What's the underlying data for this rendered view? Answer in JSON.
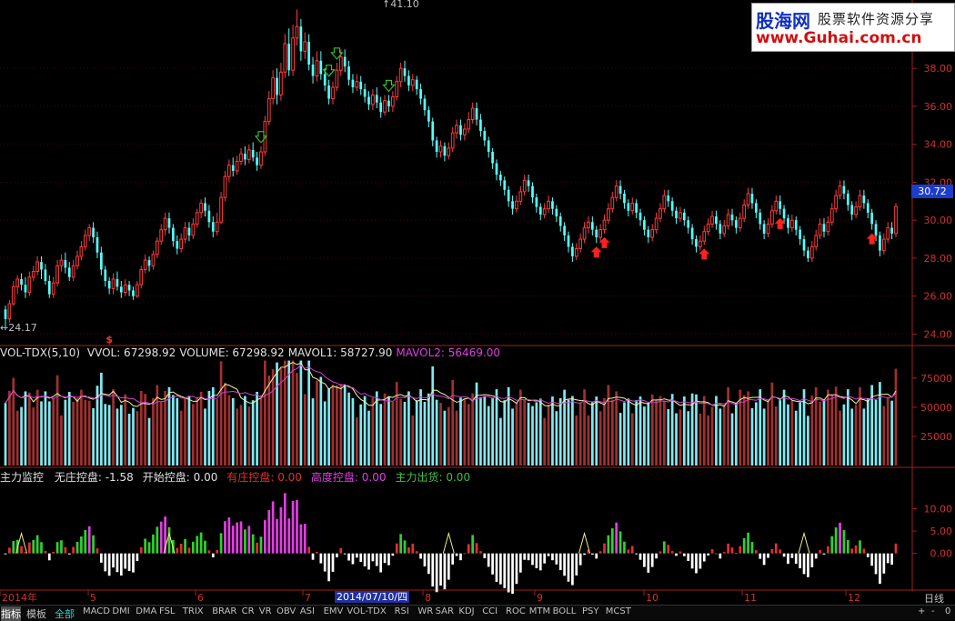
{
  "logo": {
    "brand": "股海网",
    "tagline": "股票软件资源分享",
    "url": "www.Guhai.com.cn"
  },
  "current_price": "30.72",
  "high_label": "41.10",
  "low_label": "←24.17",
  "panels": {
    "volume_title": "VOL-TDX(5,10)",
    "volume_values": [
      {
        "label": "VVOL: 67298.92",
        "color": "#e0e0e0"
      },
      {
        "label": "VOLUME: 67298.92",
        "color": "#e0e0e0"
      },
      {
        "label": "MAVOL1: 58727.90",
        "color": "#e0e0e0"
      },
      {
        "label": "MAVOL2: 56469.00",
        "color": "#e040e0"
      }
    ],
    "indicator_title": "主力监控",
    "indicator_values": [
      {
        "label": "无庄控盘: -1.58",
        "color": "#e0e0e0"
      },
      {
        "label": "开始控盘: 0.00",
        "color": "#e0e0e0"
      },
      {
        "label": "有庄控盘: 0.00",
        "color": "#e03030"
      },
      {
        "label": "高度控盘: 0.00",
        "color": "#e040e0"
      },
      {
        "label": "主力出货: 0.00",
        "color": "#40c040"
      }
    ]
  },
  "axes": {
    "price_ticks": [
      "38.00",
      "36.00",
      "34.00",
      "32.00",
      "30.00",
      "28.00",
      "26.00",
      "24.00"
    ],
    "volume_ticks": [
      "75000",
      "50000",
      "25000"
    ],
    "indicator_ticks": [
      "10.00",
      "5.00",
      "0.00"
    ],
    "months": [
      "2014年",
      "5",
      "6",
      "7",
      "8",
      "9",
      "10",
      "11",
      "12"
    ],
    "cursor_date": "2014/07/10/四",
    "period": "日线"
  },
  "bottom_tabs": {
    "left": [
      "指标",
      "模板",
      "全部"
    ],
    "indicators": [
      "MACD",
      "DMI",
      "DMA",
      "FSL",
      "TRIX",
      "BRAR",
      "CR",
      "VR",
      "OBV",
      "ASI",
      "EMV",
      "VOL-TDX",
      "RSI",
      "WR",
      "SAR",
      "KDJ",
      "CCI",
      "ROC",
      "MTM",
      "BOLL",
      "PSY",
      "MCST"
    ],
    "controls": [
      "+",
      "-",
      "0"
    ]
  },
  "chart_data": {
    "type": "candlestick",
    "ylim": [
      23.4,
      41.6
    ],
    "markers": {
      "sell_arrows_at": [
        64,
        81,
        83,
        96
      ],
      "buy_arrows_at": [
        148,
        150,
        175,
        194,
        217
      ],
      "s_marker_at": 26
    },
    "candles_desc": "[open, close, high, low] per trading day",
    "candles": [
      [
        25.3,
        24.8,
        25.5,
        24.2
      ],
      [
        24.8,
        25.6,
        25.8,
        24.6
      ],
      [
        25.6,
        26.5,
        26.8,
        25.5
      ],
      [
        26.5,
        26.9,
        27.1,
        26.1
      ],
      [
        26.9,
        26.6,
        27.2,
        26.3
      ],
      [
        26.6,
        26.2,
        27.0,
        25.9
      ],
      [
        26.2,
        27.0,
        27.3,
        26.0
      ],
      [
        27.0,
        27.3,
        27.6,
        26.8
      ],
      [
        27.3,
        27.8,
        28.1,
        27.1
      ],
      [
        27.8,
        27.4,
        28.1,
        26.9
      ],
      [
        27.4,
        26.8,
        27.7,
        26.6
      ],
      [
        26.8,
        26.1,
        27.1,
        25.9
      ],
      [
        26.1,
        26.7,
        27.0,
        25.9
      ],
      [
        26.7,
        27.6,
        27.9,
        26.5
      ],
      [
        27.6,
        27.9,
        28.2,
        27.3
      ],
      [
        27.9,
        27.5,
        28.3,
        27.2
      ],
      [
        27.5,
        27.0,
        27.8,
        26.8
      ],
      [
        27.0,
        27.6,
        27.9,
        26.8
      ],
      [
        27.6,
        28.1,
        28.4,
        27.4
      ],
      [
        28.1,
        28.6,
        28.9,
        27.9
      ],
      [
        28.6,
        29.2,
        29.5,
        28.4
      ],
      [
        29.2,
        29.6,
        29.8,
        28.9
      ],
      [
        29.6,
        29.1,
        29.9,
        28.8
      ],
      [
        29.1,
        28.3,
        29.4,
        28.0
      ],
      [
        28.3,
        27.4,
        28.6,
        27.1
      ],
      [
        27.4,
        26.8,
        27.6,
        26.5
      ],
      [
        26.8,
        26.4,
        27.0,
        26.1
      ],
      [
        26.4,
        26.9,
        27.2,
        26.1
      ],
      [
        26.9,
        26.5,
        27.3,
        26.3
      ],
      [
        26.5,
        26.2,
        26.8,
        25.9
      ],
      [
        26.2,
        26.6,
        26.9,
        26.0
      ],
      [
        26.6,
        26.3,
        26.8,
        26.0
      ],
      [
        26.3,
        26.0,
        26.5,
        25.8
      ],
      [
        26.0,
        26.6,
        26.8,
        25.9
      ],
      [
        26.6,
        27.4,
        27.6,
        26.4
      ],
      [
        27.4,
        27.9,
        28.2,
        27.2
      ],
      [
        27.9,
        27.6,
        28.1,
        27.3
      ],
      [
        27.6,
        28.2,
        28.4,
        27.4
      ],
      [
        28.2,
        28.9,
        29.1,
        28.0
      ],
      [
        28.9,
        29.5,
        29.8,
        28.7
      ],
      [
        29.5,
        30.1,
        30.4,
        29.2
      ],
      [
        30.1,
        29.6,
        30.4,
        29.3
      ],
      [
        29.6,
        28.9,
        29.8,
        28.6
      ],
      [
        28.9,
        28.5,
        29.2,
        28.2
      ],
      [
        28.5,
        29.0,
        29.3,
        28.3
      ],
      [
        29.0,
        29.6,
        29.9,
        28.8
      ],
      [
        29.6,
        29.2,
        29.9,
        28.9
      ],
      [
        29.2,
        29.8,
        30.1,
        29.0
      ],
      [
        29.8,
        30.4,
        30.6,
        29.6
      ],
      [
        30.4,
        30.9,
        31.1,
        30.1
      ],
      [
        30.9,
        30.5,
        31.2,
        30.2
      ],
      [
        30.5,
        29.9,
        30.8,
        29.6
      ],
      [
        29.9,
        29.4,
        30.2,
        29.1
      ],
      [
        29.4,
        29.9,
        30.4,
        29.2
      ],
      [
        29.9,
        31.2,
        31.5,
        29.8
      ],
      [
        31.2,
        32.3,
        32.6,
        31.0
      ],
      [
        32.3,
        32.9,
        33.2,
        32.0
      ],
      [
        32.9,
        32.6,
        33.3,
        32.3
      ],
      [
        32.6,
        33.1,
        33.4,
        32.4
      ],
      [
        33.1,
        33.5,
        33.8,
        32.9
      ],
      [
        33.5,
        33.2,
        33.9,
        32.9
      ],
      [
        33.2,
        33.7,
        34.0,
        33.0
      ],
      [
        33.7,
        33.3,
        34.1,
        33.1
      ],
      [
        33.3,
        32.9,
        33.6,
        32.6
      ],
      [
        32.9,
        33.6,
        33.9,
        32.7
      ],
      [
        33.6,
        35.2,
        35.5,
        33.4
      ],
      [
        35.2,
        36.4,
        36.8,
        35.0
      ],
      [
        36.4,
        37.5,
        37.9,
        36.1
      ],
      [
        37.5,
        36.6,
        38.0,
        36.1
      ],
      [
        36.6,
        37.8,
        38.3,
        36.3
      ],
      [
        37.8,
        39.3,
        39.8,
        37.5
      ],
      [
        39.3,
        37.9,
        40.1,
        37.6
      ],
      [
        37.9,
        39.6,
        40.3,
        37.6
      ],
      [
        39.6,
        40.2,
        41.1,
        39.2
      ],
      [
        40.2,
        38.9,
        40.6,
        38.4
      ],
      [
        38.9,
        39.4,
        39.9,
        38.5
      ],
      [
        39.4,
        38.2,
        39.8,
        37.9
      ],
      [
        38.2,
        37.6,
        38.6,
        37.2
      ],
      [
        37.6,
        38.4,
        38.9,
        37.3
      ],
      [
        38.4,
        37.7,
        38.9,
        37.4
      ],
      [
        37.7,
        37.1,
        38.0,
        36.8
      ],
      [
        37.1,
        36.4,
        37.4,
        36.1
      ],
      [
        36.4,
        37.0,
        37.3,
        36.1
      ],
      [
        37.0,
        37.9,
        38.3,
        36.8
      ],
      [
        37.9,
        38.6,
        39.0,
        37.6
      ],
      [
        38.6,
        38.1,
        39.0,
        37.8
      ],
      [
        38.1,
        37.4,
        38.4,
        37.1
      ],
      [
        37.4,
        37.0,
        37.7,
        36.7
      ],
      [
        37.0,
        37.3,
        37.7,
        36.8
      ],
      [
        37.3,
        36.9,
        37.6,
        36.6
      ],
      [
        36.9,
        36.5,
        37.2,
        36.2
      ],
      [
        36.5,
        36.1,
        36.8,
        35.8
      ],
      [
        36.1,
        36.6,
        36.9,
        35.8
      ],
      [
        36.6,
        36.2,
        37.0,
        35.9
      ],
      [
        36.2,
        35.7,
        36.5,
        35.4
      ],
      [
        35.7,
        36.3,
        36.6,
        35.5
      ],
      [
        36.3,
        36.0,
        36.6,
        35.7
      ],
      [
        36.0,
        36.5,
        36.8,
        35.7
      ],
      [
        36.5,
        37.3,
        37.6,
        36.3
      ],
      [
        37.3,
        38.0,
        38.3,
        37.0
      ],
      [
        38.0,
        37.6,
        38.4,
        37.3
      ],
      [
        37.6,
        37.1,
        37.9,
        36.8
      ],
      [
        37.1,
        37.4,
        37.7,
        36.8
      ],
      [
        37.4,
        36.9,
        37.6,
        36.6
      ],
      [
        36.9,
        36.4,
        37.2,
        36.1
      ],
      [
        36.4,
        35.8,
        36.6,
        35.5
      ],
      [
        35.8,
        35.2,
        36.0,
        34.9
      ],
      [
        35.2,
        34.2,
        35.4,
        33.9
      ],
      [
        34.2,
        33.6,
        34.4,
        33.3
      ],
      [
        33.6,
        33.9,
        34.2,
        33.3
      ],
      [
        33.9,
        33.4,
        34.1,
        33.1
      ],
      [
        33.4,
        33.8,
        34.1,
        33.2
      ],
      [
        33.8,
        34.6,
        34.9,
        33.6
      ],
      [
        34.6,
        35.0,
        35.3,
        34.3
      ],
      [
        35.0,
        34.5,
        35.3,
        34.2
      ],
      [
        34.5,
        34.8,
        35.1,
        34.2
      ],
      [
        34.8,
        35.3,
        35.7,
        34.6
      ],
      [
        35.3,
        35.9,
        36.2,
        35.1
      ],
      [
        35.9,
        35.3,
        36.2,
        35.0
      ],
      [
        35.3,
        34.7,
        35.6,
        34.4
      ],
      [
        34.7,
        34.2,
        34.9,
        33.9
      ],
      [
        34.2,
        33.6,
        34.4,
        33.3
      ],
      [
        33.6,
        33.0,
        33.8,
        32.7
      ],
      [
        33.0,
        32.4,
        33.2,
        32.1
      ],
      [
        32.4,
        32.1,
        32.6,
        31.8
      ],
      [
        32.1,
        31.6,
        32.3,
        31.3
      ],
      [
        31.6,
        31.0,
        31.8,
        30.7
      ],
      [
        31.0,
        30.6,
        31.3,
        30.3
      ],
      [
        30.6,
        31.0,
        31.3,
        30.4
      ],
      [
        31.0,
        31.5,
        31.8,
        30.8
      ],
      [
        31.5,
        32.1,
        32.4,
        31.3
      ],
      [
        32.1,
        31.8,
        32.4,
        31.5
      ],
      [
        31.8,
        31.2,
        32.0,
        30.9
      ],
      [
        31.2,
        30.7,
        31.4,
        30.4
      ],
      [
        30.7,
        30.3,
        30.9,
        30.0
      ],
      [
        30.3,
        30.6,
        30.9,
        30.1
      ],
      [
        30.6,
        31.0,
        31.3,
        30.4
      ],
      [
        31.0,
        30.6,
        31.2,
        30.3
      ],
      [
        30.6,
        30.2,
        30.8,
        29.9
      ],
      [
        30.2,
        29.7,
        30.4,
        29.4
      ],
      [
        29.7,
        29.2,
        29.9,
        28.9
      ],
      [
        29.2,
        28.6,
        29.4,
        28.3
      ],
      [
        28.6,
        28.1,
        28.8,
        27.8
      ],
      [
        28.1,
        28.5,
        28.8,
        27.9
      ],
      [
        28.5,
        29.0,
        29.3,
        28.3
      ],
      [
        29.0,
        29.6,
        29.9,
        28.8
      ],
      [
        29.6,
        29.9,
        30.2,
        29.3
      ],
      [
        29.9,
        29.5,
        30.2,
        29.2
      ],
      [
        29.5,
        29.1,
        29.7,
        28.8
      ],
      [
        29.1,
        29.5,
        29.8,
        28.9
      ],
      [
        29.5,
        30.0,
        30.3,
        29.3
      ],
      [
        30.0,
        30.6,
        30.9,
        29.8
      ],
      [
        30.6,
        31.2,
        31.5,
        30.4
      ],
      [
        31.2,
        31.8,
        32.1,
        31.0
      ],
      [
        31.8,
        31.4,
        32.1,
        31.1
      ],
      [
        31.4,
        30.9,
        31.6,
        30.6
      ],
      [
        30.9,
        30.5,
        31.1,
        30.2
      ],
      [
        30.5,
        30.9,
        31.2,
        30.3
      ],
      [
        30.9,
        30.4,
        31.1,
        30.1
      ],
      [
        30.4,
        30.0,
        30.6,
        29.7
      ],
      [
        30.0,
        29.5,
        30.2,
        29.2
      ],
      [
        29.5,
        29.1,
        29.7,
        28.8
      ],
      [
        29.1,
        29.5,
        29.8,
        28.9
      ],
      [
        29.5,
        30.1,
        30.4,
        29.3
      ],
      [
        30.1,
        30.6,
        30.9,
        29.9
      ],
      [
        30.6,
        31.3,
        31.6,
        30.4
      ],
      [
        31.3,
        31.0,
        31.6,
        30.7
      ],
      [
        31.0,
        30.5,
        31.2,
        30.2
      ],
      [
        30.5,
        30.1,
        30.7,
        29.8
      ],
      [
        30.1,
        30.4,
        30.7,
        29.9
      ],
      [
        30.4,
        30.0,
        30.6,
        29.7
      ],
      [
        30.0,
        29.6,
        30.2,
        29.3
      ],
      [
        29.6,
        29.0,
        29.8,
        28.7
      ],
      [
        29.0,
        28.6,
        29.2,
        28.3
      ],
      [
        28.6,
        28.9,
        29.2,
        28.4
      ],
      [
        28.9,
        29.4,
        29.7,
        28.7
      ],
      [
        29.4,
        29.8,
        30.1,
        29.2
      ],
      [
        29.8,
        30.2,
        30.5,
        29.6
      ],
      [
        30.2,
        29.8,
        30.5,
        29.5
      ],
      [
        29.8,
        29.3,
        30.0,
        29.0
      ],
      [
        29.3,
        29.7,
        30.0,
        29.1
      ],
      [
        29.7,
        30.3,
        30.6,
        29.5
      ],
      [
        30.3,
        30.0,
        30.6,
        29.7
      ],
      [
        30.0,
        29.6,
        30.2,
        29.3
      ],
      [
        29.6,
        30.1,
        30.4,
        29.4
      ],
      [
        30.1,
        30.8,
        31.1,
        29.9
      ],
      [
        30.8,
        31.4,
        31.7,
        30.6
      ],
      [
        31.4,
        30.9,
        31.7,
        30.6
      ],
      [
        30.9,
        30.4,
        31.1,
        30.1
      ],
      [
        30.4,
        29.8,
        30.6,
        29.5
      ],
      [
        29.8,
        29.3,
        30.0,
        29.0
      ],
      [
        29.3,
        29.8,
        30.1,
        29.1
      ],
      [
        29.8,
        30.5,
        30.8,
        29.6
      ],
      [
        30.5,
        31.0,
        31.3,
        30.3
      ],
      [
        31.0,
        30.6,
        31.3,
        30.3
      ],
      [
        30.6,
        30.1,
        30.8,
        29.8
      ],
      [
        30.1,
        29.6,
        30.3,
        29.3
      ],
      [
        29.6,
        30.0,
        30.3,
        29.4
      ],
      [
        30.0,
        29.5,
        30.2,
        29.2
      ],
      [
        29.5,
        29.0,
        29.7,
        28.7
      ],
      [
        29.0,
        28.4,
        29.2,
        28.1
      ],
      [
        28.4,
        28.0,
        28.6,
        27.8
      ],
      [
        28.0,
        28.6,
        28.9,
        27.8
      ],
      [
        28.6,
        29.2,
        29.5,
        28.4
      ],
      [
        29.2,
        29.8,
        30.1,
        29.0
      ],
      [
        29.8,
        29.4,
        30.1,
        29.1
      ],
      [
        29.4,
        29.9,
        30.2,
        29.2
      ],
      [
        29.9,
        30.6,
        30.9,
        29.7
      ],
      [
        30.6,
        31.3,
        31.6,
        30.4
      ],
      [
        31.3,
        31.8,
        32.1,
        31.1
      ],
      [
        31.8,
        31.4,
        32.1,
        31.1
      ],
      [
        31.4,
        30.8,
        31.6,
        30.5
      ],
      [
        30.8,
        30.3,
        31.0,
        30.0
      ],
      [
        30.3,
        30.7,
        31.0,
        30.1
      ],
      [
        30.7,
        31.3,
        31.6,
        30.5
      ],
      [
        31.3,
        30.9,
        31.6,
        30.6
      ],
      [
        30.9,
        30.4,
        31.1,
        30.1
      ],
      [
        30.4,
        29.8,
        30.6,
        29.5
      ],
      [
        29.8,
        29.2,
        30.0,
        28.9
      ],
      [
        29.2,
        28.4,
        29.4,
        28.1
      ],
      [
        28.4,
        29.0,
        29.3,
        28.2
      ],
      [
        29.0,
        29.6,
        29.9,
        28.8
      ],
      [
        29.6,
        29.3,
        29.9,
        29.0
      ],
      [
        29.3,
        30.72,
        30.9,
        29.1
      ]
    ],
    "volume_scale": "[0, 92000]",
    "indicator_ylim": [
      -8,
      16
    ]
  }
}
